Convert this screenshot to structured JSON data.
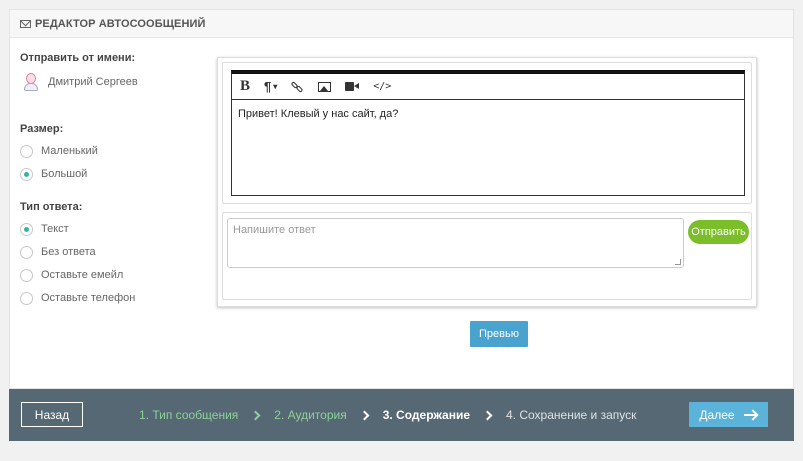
{
  "header": {
    "title": "РЕДАКТОР АВТОСООБЩЕНИЙ",
    "icon": "envelope-icon"
  },
  "sender": {
    "label": "Отправить от имени:",
    "name": "Дмитрий Сергеев"
  },
  "size": {
    "label": "Размер:",
    "options": [
      {
        "label": "Маленький",
        "checked": false
      },
      {
        "label": "Большой",
        "checked": true
      }
    ]
  },
  "reply_type": {
    "label": "Тип ответа:",
    "options": [
      {
        "label": "Текст",
        "checked": true
      },
      {
        "label": "Без ответа",
        "checked": false
      },
      {
        "label": "Оставьте емейл",
        "checked": false
      },
      {
        "label": "Оставьте телефон",
        "checked": false
      }
    ]
  },
  "editor": {
    "toolbar": [
      "bold-icon",
      "paragraph-icon",
      "link-icon",
      "image-icon",
      "video-icon",
      "code-icon"
    ],
    "bold_glyph": "B",
    "para_glyph": "¶",
    "code_glyph": "</>",
    "message": "Привет! Клевый у нас сайт, да?"
  },
  "reply": {
    "placeholder": "Напишите ответ",
    "send_label": "Отправить"
  },
  "preview_label": "Превью",
  "footer": {
    "back_label": "Назад",
    "steps": [
      {
        "label": "1. Тип сообщения",
        "state": "done"
      },
      {
        "label": "2. Аудитория",
        "state": "done"
      },
      {
        "label": "3. Содержание",
        "state": "active"
      },
      {
        "label": "4. Сохранение и запуск",
        "state": "future"
      }
    ],
    "next_label": "Далее"
  },
  "colors": {
    "accent_green": "#7cbd2a",
    "accent_blue": "#4aa3cf",
    "footer_bg": "#566873",
    "radio_checked": "#36b3a7"
  }
}
